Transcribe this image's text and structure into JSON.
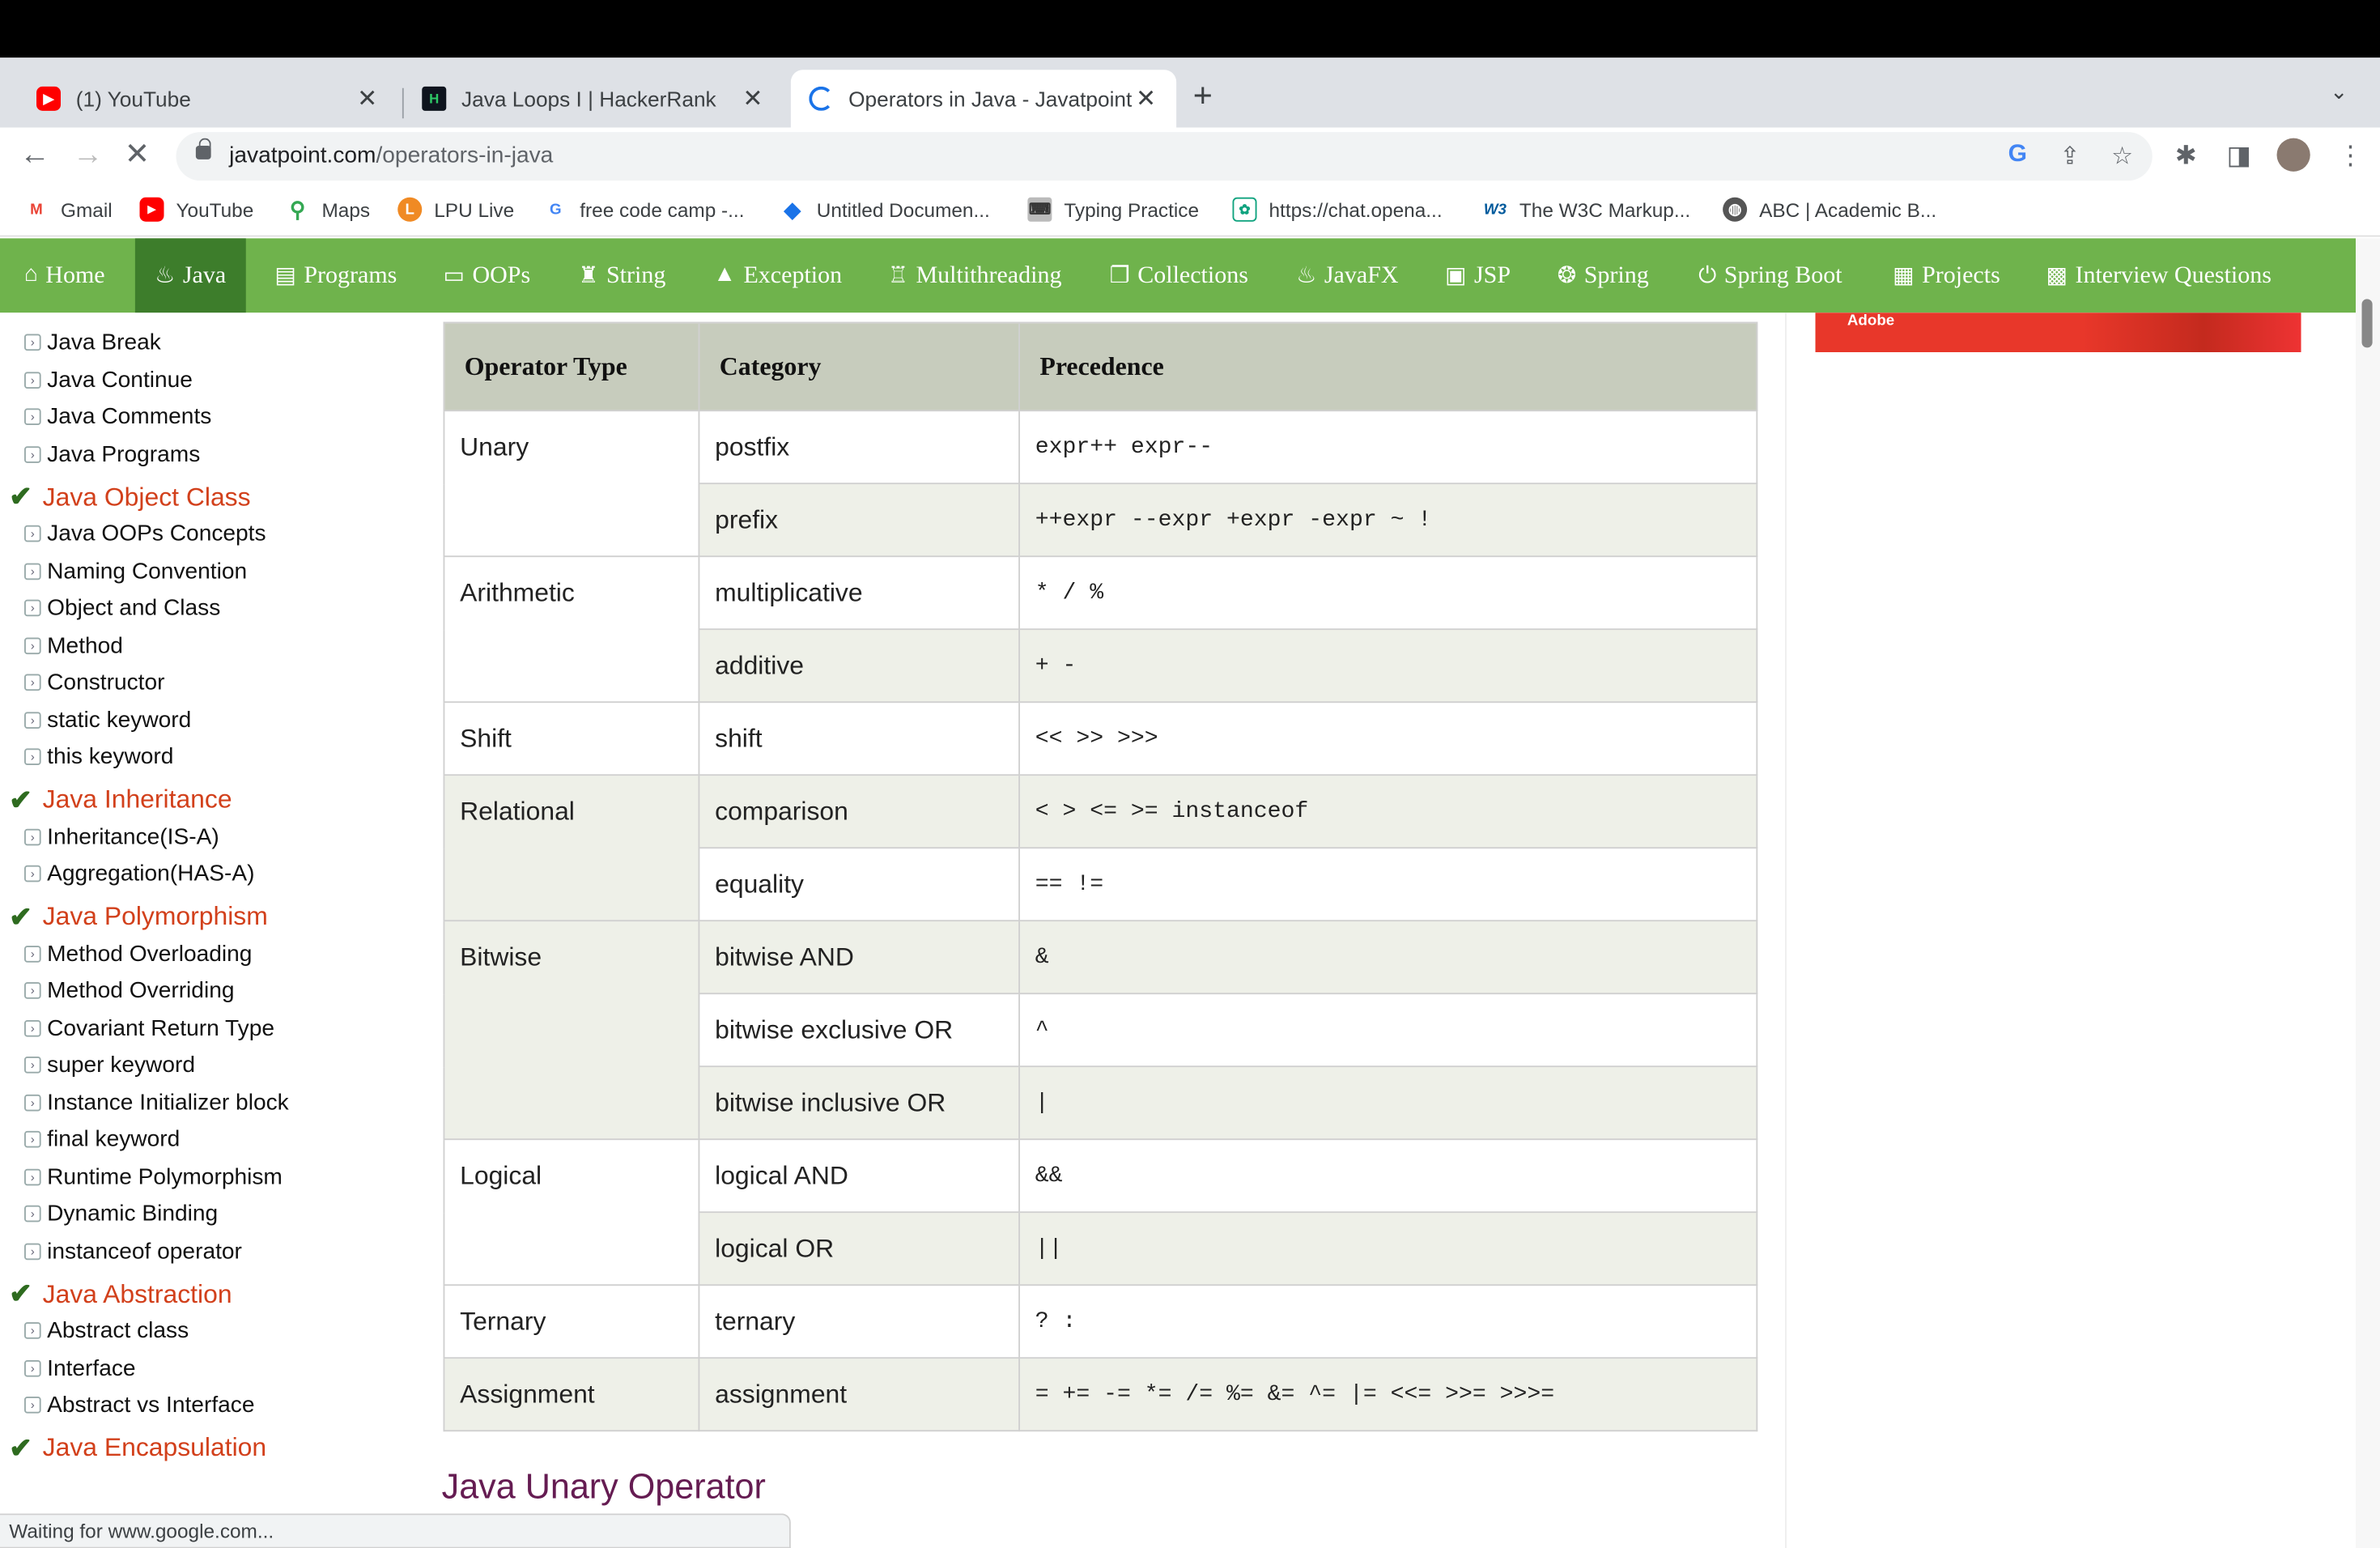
{
  "browser": {
    "tabs": [
      {
        "title": "(1) YouTube",
        "icon": "youtube-icon"
      },
      {
        "title": "Java Loops I | HackerRank",
        "icon": "hackerrank-icon"
      },
      {
        "title": "Operators in Java - Javatpoint",
        "icon": "loading-spinner-icon",
        "active": true
      }
    ],
    "url_host": "javatpoint.com",
    "url_path": "/operators-in-java",
    "status_text": "Waiting for www.google.com..."
  },
  "bookmarks": [
    {
      "label": "Gmail",
      "icon": "gmail-icon"
    },
    {
      "label": "YouTube",
      "icon": "youtube-icon"
    },
    {
      "label": "Maps",
      "icon": "maps-icon"
    },
    {
      "label": "LPU Live",
      "icon": "lpu-icon"
    },
    {
      "label": "free code camp -...",
      "icon": "google-icon"
    },
    {
      "label": "Untitled Documen...",
      "icon": "docs-icon"
    },
    {
      "label": "Typing Practice",
      "icon": "typing-icon"
    },
    {
      "label": "https://chat.opena...",
      "icon": "openai-icon"
    },
    {
      "label": "The W3C Markup...",
      "icon": "w3c-icon"
    },
    {
      "label": "ABC | Academic B...",
      "icon": "globe-icon"
    }
  ],
  "menu": [
    {
      "label": "Home",
      "icon": "home-icon"
    },
    {
      "label": "Java",
      "icon": "java-icon",
      "active": true
    },
    {
      "label": "Programs",
      "icon": "programs-icon"
    },
    {
      "label": "OOPs",
      "icon": "oops-icon"
    },
    {
      "label": "String",
      "icon": "string-icon"
    },
    {
      "label": "Exception",
      "icon": "warning-icon"
    },
    {
      "label": "Multithreading",
      "icon": "thread-icon"
    },
    {
      "label": "Collections",
      "icon": "collections-icon"
    },
    {
      "label": "JavaFX",
      "icon": "javafx-icon"
    },
    {
      "label": "JSP",
      "icon": "jsp-icon"
    },
    {
      "label": "Spring",
      "icon": "spring-icon"
    },
    {
      "label": "Spring Boot",
      "icon": "power-icon"
    },
    {
      "label": "Projects",
      "icon": "projects-icon"
    },
    {
      "label": "Interview Questions",
      "icon": "interview-icon"
    }
  ],
  "sidebar": {
    "items": [
      {
        "type": "link",
        "label": "Java Break"
      },
      {
        "type": "link",
        "label": "Java Continue"
      },
      {
        "type": "link",
        "label": "Java Comments"
      },
      {
        "type": "link",
        "label": "Java Programs"
      },
      {
        "type": "head",
        "label": "Java Object Class"
      },
      {
        "type": "link",
        "label": "Java OOPs Concepts"
      },
      {
        "type": "link",
        "label": "Naming Convention"
      },
      {
        "type": "link",
        "label": "Object and Class"
      },
      {
        "type": "link",
        "label": "Method"
      },
      {
        "type": "link",
        "label": "Constructor"
      },
      {
        "type": "link",
        "label": "static keyword"
      },
      {
        "type": "link",
        "label": "this keyword"
      },
      {
        "type": "head",
        "label": "Java Inheritance"
      },
      {
        "type": "link",
        "label": "Inheritance(IS-A)"
      },
      {
        "type": "link",
        "label": "Aggregation(HAS-A)"
      },
      {
        "type": "head",
        "label": "Java Polymorphism"
      },
      {
        "type": "link",
        "label": "Method Overloading"
      },
      {
        "type": "link",
        "label": "Method Overriding"
      },
      {
        "type": "link",
        "label": "Covariant Return Type"
      },
      {
        "type": "link",
        "label": "super keyword"
      },
      {
        "type": "link",
        "label": "Instance Initializer block"
      },
      {
        "type": "link",
        "label": "final keyword"
      },
      {
        "type": "link",
        "label": "Runtime Polymorphism"
      },
      {
        "type": "link",
        "label": "Dynamic Binding"
      },
      {
        "type": "link",
        "label": "instanceof operator"
      },
      {
        "type": "head",
        "label": "Java Abstraction"
      },
      {
        "type": "link",
        "label": "Abstract class"
      },
      {
        "type": "link",
        "label": "Interface"
      },
      {
        "type": "link",
        "label": "Abstract vs Interface"
      },
      {
        "type": "head",
        "label": "Java Encapsulation"
      }
    ]
  },
  "ad": {
    "text": "Adobe"
  },
  "table": {
    "headers": [
      "Operator Type",
      "Category",
      "Precedence"
    ],
    "groups": [
      {
        "type": "Unary",
        "rows": [
          {
            "category": "postfix",
            "precedence": "expr++ expr--"
          },
          {
            "category": "prefix",
            "precedence": "++expr --expr +expr -expr ~ !"
          }
        ]
      },
      {
        "type": "Arithmetic",
        "rows": [
          {
            "category": "multiplicative",
            "precedence": "* / %"
          },
          {
            "category": "additive",
            "precedence": "+ -"
          }
        ]
      },
      {
        "type": "Shift",
        "rows": [
          {
            "category": "shift",
            "precedence": "<< >> >>>"
          }
        ]
      },
      {
        "type": "Relational",
        "rows": [
          {
            "category": "comparison",
            "precedence": "< > <= >= instanceof"
          },
          {
            "category": "equality",
            "precedence": "== !="
          }
        ]
      },
      {
        "type": "Bitwise",
        "rows": [
          {
            "category": "bitwise AND",
            "precedence": "&"
          },
          {
            "category": "bitwise exclusive OR",
            "precedence": "^"
          },
          {
            "category": "bitwise inclusive OR",
            "precedence": "|"
          }
        ]
      },
      {
        "type": "Logical",
        "rows": [
          {
            "category": "logical AND",
            "precedence": "&&"
          },
          {
            "category": "logical OR",
            "precedence": "||"
          }
        ]
      },
      {
        "type": "Ternary",
        "rows": [
          {
            "category": "ternary",
            "precedence": "? :"
          }
        ]
      },
      {
        "type": "Assignment",
        "rows": [
          {
            "category": "assignment",
            "precedence": "= += -= *= /= %= &= ^= |= <<= >>= >>>="
          }
        ]
      }
    ]
  },
  "section_heading": "Java Unary Operator",
  "colors": {
    "menu_green": "#6fb34c",
    "menu_active": "#3d7d2b",
    "sidebar_head": "#d2401b",
    "heading": "#651c52"
  }
}
